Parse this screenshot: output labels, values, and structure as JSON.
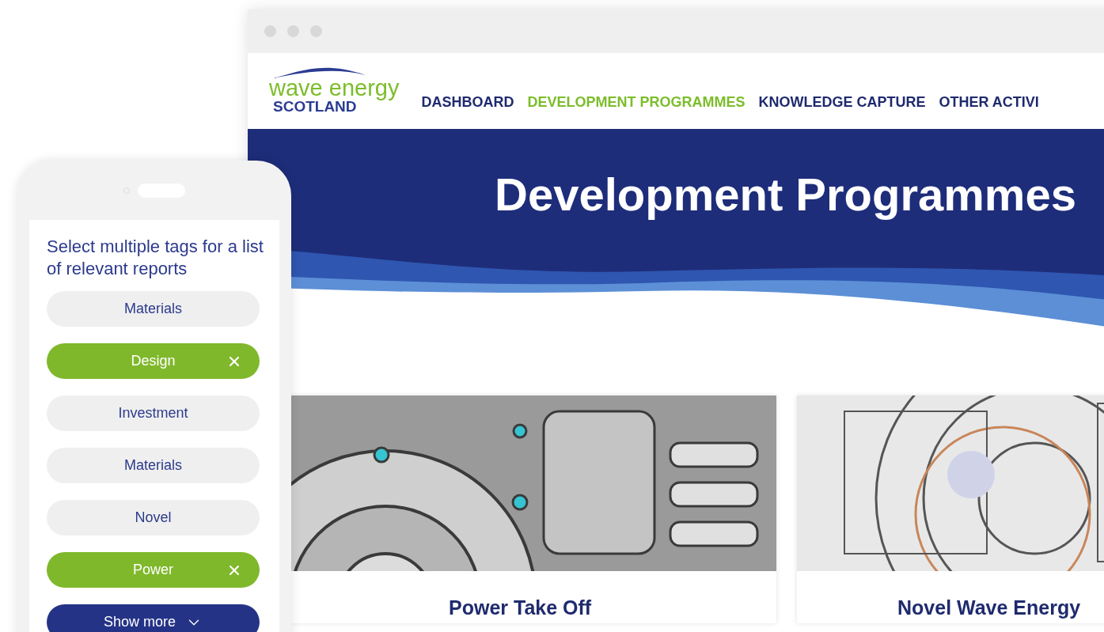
{
  "browser": {
    "logo": {
      "line_1": "wave energy",
      "line_2": "SCOTLAND"
    },
    "nav": [
      {
        "label": "DASHBOARD",
        "selected": false
      },
      {
        "label": "DEVELOPMENT PROGRAMMES",
        "selected": true
      },
      {
        "label": "KNOWLEDGE CAPTURE",
        "selected": false
      },
      {
        "label": "OTHER ACTIVI",
        "selected": false
      }
    ],
    "hero": {
      "title": "Development Programmes"
    },
    "cards": [
      {
        "title": "Power Take Off"
      },
      {
        "title": "Novel Wave Energy"
      }
    ]
  },
  "phone": {
    "heading": "Select multiple tags for a list of relevant reports",
    "tags": [
      {
        "label": "Materials",
        "selected": false
      },
      {
        "label": "Design",
        "selected": true
      },
      {
        "label": "Investment",
        "selected": false
      },
      {
        "label": "Materials",
        "selected": false
      },
      {
        "label": "Novel",
        "selected": false
      },
      {
        "label": "Power",
        "selected": true
      }
    ],
    "show_more": "Show more"
  }
}
